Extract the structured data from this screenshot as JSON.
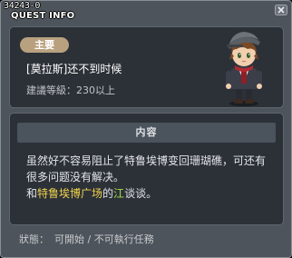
{
  "quest": {
    "id_text": "34243-0",
    "window_title": "QUEST INFO",
    "type_badge": "主要",
    "name": "[莫拉斯]还不到时候",
    "level_requirement": "建議等級：230以上"
  },
  "content": {
    "header": "内容",
    "line1": "虽然好不容易阻止了特鲁埃博变回珊瑚礁，可还有",
    "line2": "很多问题没有解决。",
    "line3_prefix": "和",
    "line3_npc": "特鲁埃博广场",
    "line3_mid": "的",
    "line3_npc2": "江",
    "line3_suffix": "谈谈。"
  },
  "status": {
    "label": "狀態：",
    "value1": "可開始",
    "separator": "/",
    "value2": "不可執行任務"
  },
  "colors": {
    "window_bg": "#4e545b",
    "panel_bg": "#2c3138",
    "badge_bg": "#b9a17f",
    "highlight_yellow": "#f1d24b",
    "highlight_green": "#a8e04a"
  },
  "icons": [
    "close-icon",
    "npc-portrait"
  ]
}
